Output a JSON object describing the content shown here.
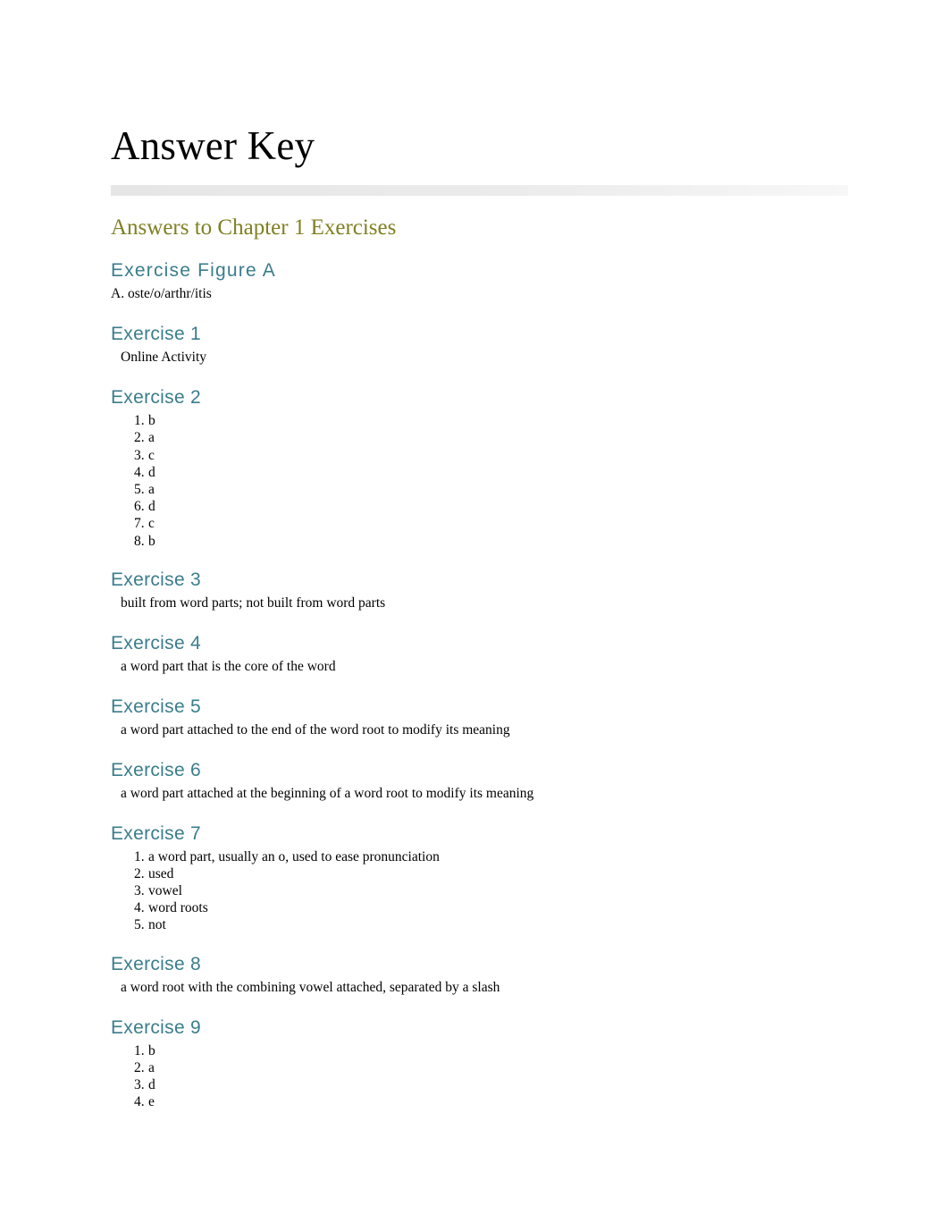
{
  "document": {
    "title": "Answer Key",
    "section_heading": "Answers to Chapter 1 Exercises",
    "sections": [
      {
        "heading": "Exercise Figure A",
        "spaced": true,
        "type": "text",
        "lines": [
          "A. oste/o/arthr/itis"
        ],
        "indent": "indent-1"
      },
      {
        "heading": "Exercise 1",
        "spaced": false,
        "type": "text",
        "lines": [
          "Online Activity"
        ],
        "indent": "indent-2"
      },
      {
        "heading": "Exercise 2",
        "spaced": false,
        "type": "list",
        "items": [
          {
            "num": "1.",
            "text": "b"
          },
          {
            "num": "2.",
            "text": "a"
          },
          {
            "num": "3.",
            "text": "c"
          },
          {
            "num": "4.",
            "text": "d"
          },
          {
            "num": "5.",
            "text": "a"
          },
          {
            "num": "6.",
            "text": "d"
          },
          {
            "num": "7.",
            "text": "c"
          },
          {
            "num": "8.",
            "text": "b"
          }
        ]
      },
      {
        "heading": "Exercise 3",
        "spaced": false,
        "type": "text",
        "lines": [
          "built from word parts; not built from word parts"
        ],
        "indent": "indent-2"
      },
      {
        "heading": "Exercise 4",
        "spaced": false,
        "type": "text",
        "lines": [
          "a word part that is the core of the word"
        ],
        "indent": "indent-2"
      },
      {
        "heading": "Exercise 5",
        "spaced": false,
        "type": "text",
        "lines": [
          "a word part attached to the end of the word root to modify its meaning"
        ],
        "indent": "indent-2"
      },
      {
        "heading": "Exercise 6",
        "spaced": false,
        "type": "text",
        "lines": [
          "a word part attached at the beginning of a word root to modify its meaning"
        ],
        "indent": "indent-2"
      },
      {
        "heading": "Exercise 7",
        "spaced": false,
        "type": "list",
        "items": [
          {
            "num": "1.",
            "text": "a word part, usually an o, used to ease pronunciation"
          },
          {
            "num": "2.",
            "text": "used"
          },
          {
            "num": "3.",
            "text": "vowel"
          },
          {
            "num": "4.",
            "text": "word roots"
          },
          {
            "num": "5.",
            "text": "not"
          }
        ]
      },
      {
        "heading": "Exercise 8",
        "spaced": false,
        "type": "text",
        "lines": [
          "a word root with the combining vowel attached, separated by a slash"
        ],
        "indent": "indent-2"
      },
      {
        "heading": "Exercise 9",
        "spaced": false,
        "type": "list",
        "items": [
          {
            "num": "1.",
            "text": "b"
          },
          {
            "num": "2.",
            "text": "a"
          },
          {
            "num": "3.",
            "text": "d"
          },
          {
            "num": "4.",
            "text": "e"
          }
        ]
      }
    ]
  },
  "colors": {
    "title": "#000000",
    "section_heading": "#7f7f22",
    "exercise_heading": "#3a7d8c",
    "rule": "#e6e6e6"
  }
}
